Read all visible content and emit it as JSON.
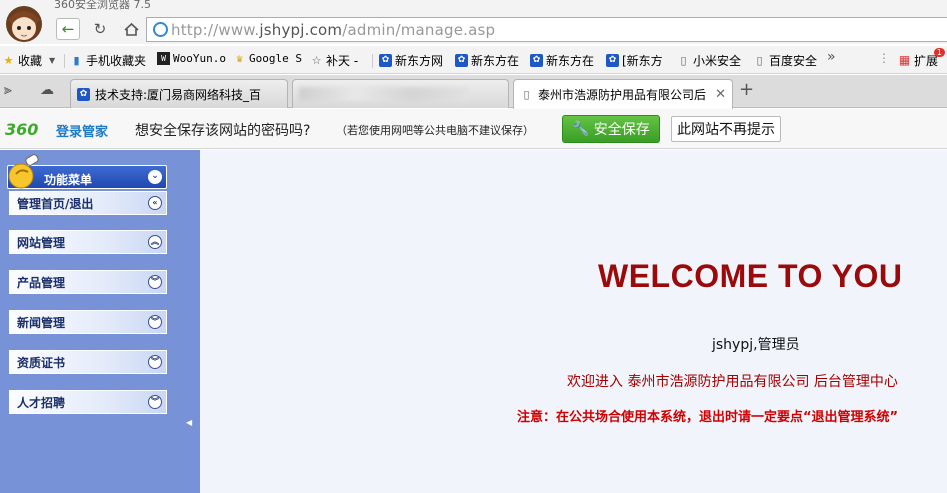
{
  "browser": {
    "title": "360安全浏览器 7.5",
    "url_scheme": "http://www.",
    "url_host": "jshypj.com",
    "url_path": "/admin/manage.asp"
  },
  "bookmarks": {
    "favorites": "收藏",
    "items": [
      "手机收藏夹",
      "WooYun.o",
      "Google S",
      "补天 -",
      "新东方网",
      "新东方在",
      "新东方在",
      "[新东方",
      "小米安全",
      "百度安全"
    ],
    "more": "»",
    "extensions": "扩展",
    "ext_badge": "1"
  },
  "tabs": [
    {
      "title": "技术支持:厦门易商网络科技_百"
    },
    {
      "title": ""
    },
    {
      "title": "泰州市浩源防护用品有限公司后"
    }
  ],
  "password_bar": {
    "logo": "360",
    "logo_text": "登录管家",
    "question": "想安全保存该网站的密码吗?",
    "hint": "（若您使用网吧等公共电脑不建议保存）",
    "save_button": "安全保存",
    "never_button": "此网站不再提示"
  },
  "sidebar": {
    "header": "功能菜单",
    "items": [
      {
        "label": "管理首页/退出",
        "icon": "chevron-left-icon"
      },
      {
        "label": "网站管理",
        "icon": "chevron-up-icon"
      },
      {
        "label": "产品管理",
        "icon": "chevron-down-icon"
      },
      {
        "label": "新闻管理",
        "icon": "chevron-down-icon"
      },
      {
        "label": "资质证书",
        "icon": "chevron-down-icon"
      },
      {
        "label": "人才招聘",
        "icon": "chevron-down-icon"
      }
    ]
  },
  "main": {
    "welcome": "WELCOME TO YOU",
    "user_line": "jshypj,管理员",
    "enter_line": "欢迎进入 泰州市浩源防护用品有限公司  后台管理中心",
    "warn_line": "注意：在公共场合使用本系统，退出时请一定要点“退出管理系统”"
  },
  "colors": {
    "sidebar_bg": "#7792d6",
    "welcome": "#9b0a0a",
    "warning": "#d00000",
    "save_green": "#4db034"
  }
}
